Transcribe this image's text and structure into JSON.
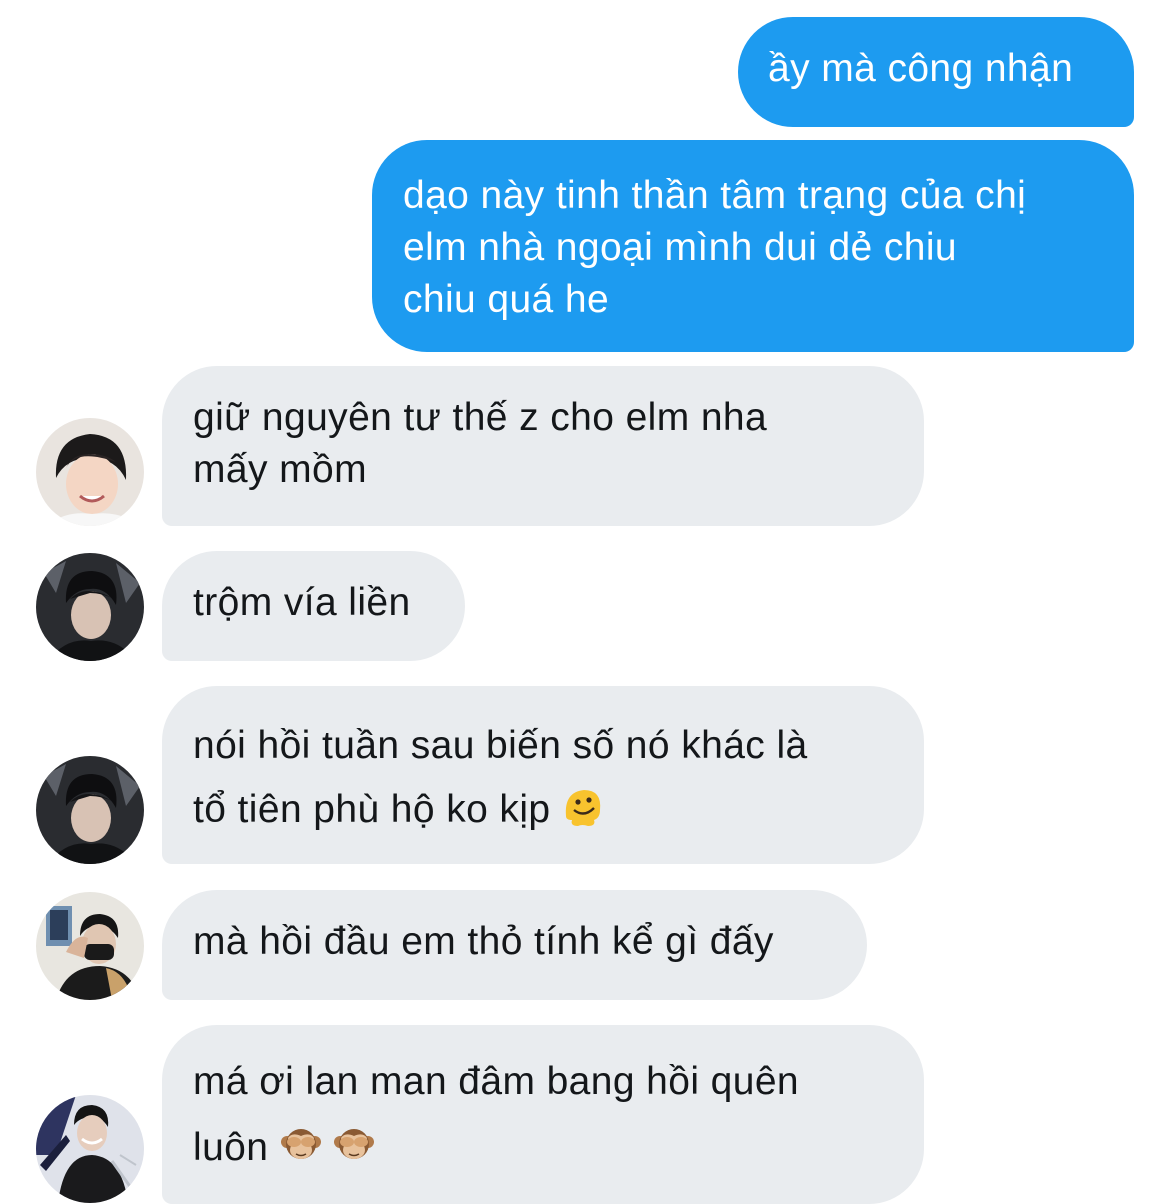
{
  "messages": {
    "out1": {
      "text": "ầy mà công nhận"
    },
    "out2": {
      "lines": [
        "dạo này tinh thần tâm trạng của chị",
        "elm nhà ngoại mình dui dẻ chiu",
        "chiu quá he"
      ]
    },
    "in1": {
      "lines": [
        "giữ nguyên tư thế z cho elm nha",
        "mấy mồm"
      ]
    },
    "in2": {
      "text": "trộm vía liền"
    },
    "in3": {
      "lines": [
        "nói hồi tuần sau biến số nó khác là",
        "tổ tiên phù hộ ko kịp"
      ],
      "emoji": "melting-face-emoji"
    },
    "in4": {
      "text": "mà hồi đầu em thỏ tính kể gì đấy"
    },
    "in5": {
      "lines": [
        "má ơi lan man đâm bang hồi quên",
        "luôn"
      ],
      "emoji": [
        "see-no-evil-monkey-emoji",
        "see-no-evil-monkey-emoji"
      ]
    }
  },
  "colors": {
    "outgoing_bubble": "#1d9bf0",
    "incoming_bubble": "#e9ecef",
    "incoming_text": "#14171a"
  }
}
